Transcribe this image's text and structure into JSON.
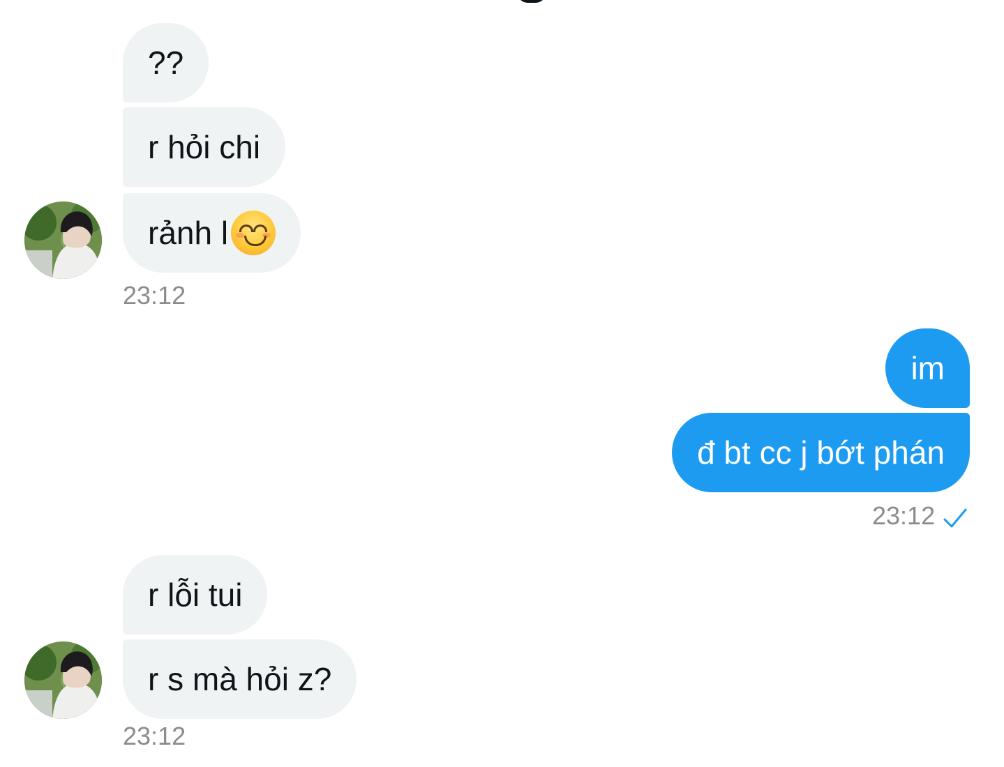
{
  "conversation": {
    "incoming_group_1": {
      "messages": [
        "??",
        "r hỏi chi",
        "rảnh l"
      ],
      "last_message_emoji": "smiling-face-with-smiling-eyes-emoji",
      "timestamp": "23:12"
    },
    "outgoing_group_1": {
      "messages": [
        "im",
        "đ bt cc j bớt phán"
      ],
      "timestamp": "23:12",
      "status_icon": "sent-check-icon"
    },
    "incoming_group_2": {
      "messages": [
        "r lỗi tui",
        "r s mà hỏi z?"
      ],
      "timestamp": "23:12"
    }
  },
  "colors": {
    "incoming_bubble": "#eff3f4",
    "outgoing_bubble": "#1d9bf0",
    "timestamp": "#8b8b8b",
    "check": "#1d9bf0",
    "text": "#0f1419"
  }
}
